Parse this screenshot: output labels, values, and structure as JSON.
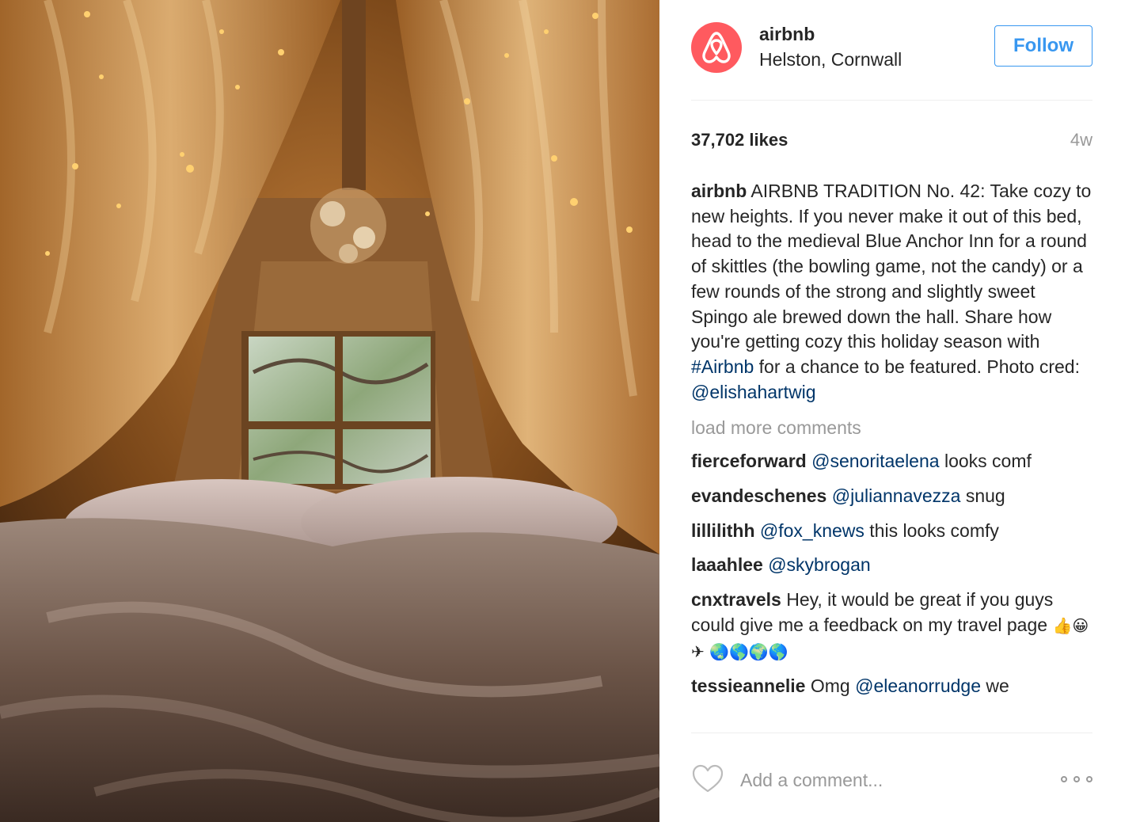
{
  "post": {
    "username": "airbnb",
    "location": "Helston, Cornwall",
    "follow_label": "Follow",
    "likes": "37,702 likes",
    "time": "4w",
    "caption": {
      "user": "airbnb",
      "text_1": " AIRBNB TRADITION No. 42: Take cozy to new heights. If you never make it out of this bed, head to the medieval Blue Anchor Inn for a round of skittles (the bowling game, not the candy) or a few rounds of the strong and slightly sweet Spingo ale brewed down the hall. Share how you're getting cozy this holiday season with ",
      "hashtag": "#Airbnb",
      "text_2": " for a chance to be featured. Photo cred: ",
      "mention": "@elishahartwig"
    },
    "load_more": "load more comments",
    "comments": [
      {
        "user": "fierceforward",
        "mention": "@senoritaelena",
        "text": " looks comf"
      },
      {
        "user": "evandeschenes",
        "mention": "@juliannavezza",
        "text": " snug"
      },
      {
        "user": "lillilithh",
        "mention": "@fox_knews",
        "text": " this looks comfy"
      },
      {
        "user": "laaahlee",
        "mention": "@skybrogan",
        "text": ""
      },
      {
        "user": "cnxtravels",
        "mention": "",
        "text": " Hey, it would be great if you guys could give me a feedback on my travel page ",
        "emoji": "👍😀✈ 🌏🌎🌍🌎"
      },
      {
        "user": "tessieannelie",
        "mention": "",
        "text": " Omg ",
        "mention2": "@eleanorrudge",
        "text2": " we"
      }
    ],
    "add_comment_placeholder": "Add a comment...",
    "icons": {
      "avatar": "airbnb-logo-icon",
      "like": "heart-icon",
      "more": "more-options-icon"
    },
    "colors": {
      "brand": "#ff5a5f",
      "follow": "#3897f0",
      "link": "#003569",
      "muted": "#999999"
    }
  }
}
